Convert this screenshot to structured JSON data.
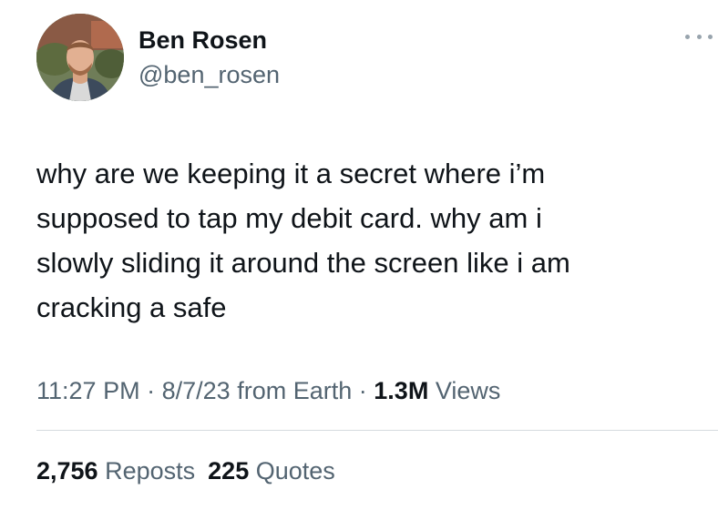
{
  "author": {
    "display_name": "Ben Rosen",
    "handle": "@ben_rosen"
  },
  "tweet": {
    "lines": [
      "why are we keeping it a secret where i’m",
      "supposed to tap my debit card. why am i",
      "slowly sliding it around the screen like i am",
      "cracking a safe"
    ]
  },
  "meta": {
    "time": "11:27 PM",
    "separator": "·",
    "date": "8/7/23",
    "source": "from Earth",
    "views_count": "1.3M",
    "views_label": "Views"
  },
  "stats": {
    "reposts_count": "2,756",
    "reposts_label": "Reposts",
    "quotes_count": "225",
    "quotes_label": "Quotes"
  },
  "icons": {
    "more": "more-options-icon"
  },
  "colors": {
    "text_primary": "#0f1419",
    "text_secondary": "#536471",
    "divider": "#d6dbdf",
    "background": "#ffffff"
  }
}
